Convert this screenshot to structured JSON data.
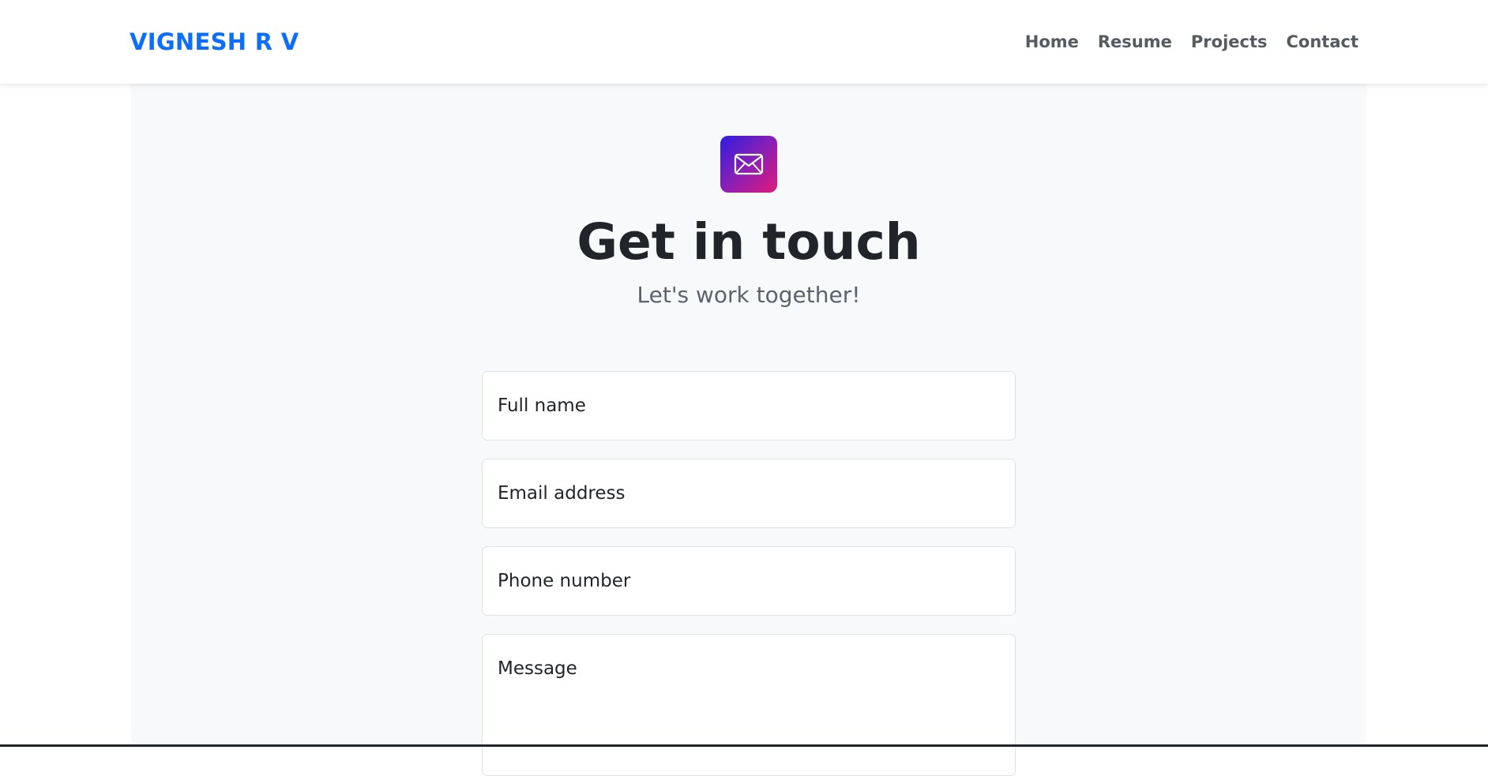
{
  "navbar": {
    "brand": "VIGNESH R V",
    "links": [
      "Home",
      "Resume",
      "Projects",
      "Contact"
    ]
  },
  "hero": {
    "icon": "envelope-icon",
    "title": "Get in touch",
    "subtitle": "Let's work together!"
  },
  "form": {
    "full_name": "Full name",
    "email": "Email address",
    "phone": "Phone number",
    "message": "Message"
  },
  "colors": {
    "brand": "#0d6efd",
    "icon_gradient_start": "#2d1ee0",
    "icon_gradient_end": "#df1a7a",
    "section_bg": "#f8f9fa"
  }
}
